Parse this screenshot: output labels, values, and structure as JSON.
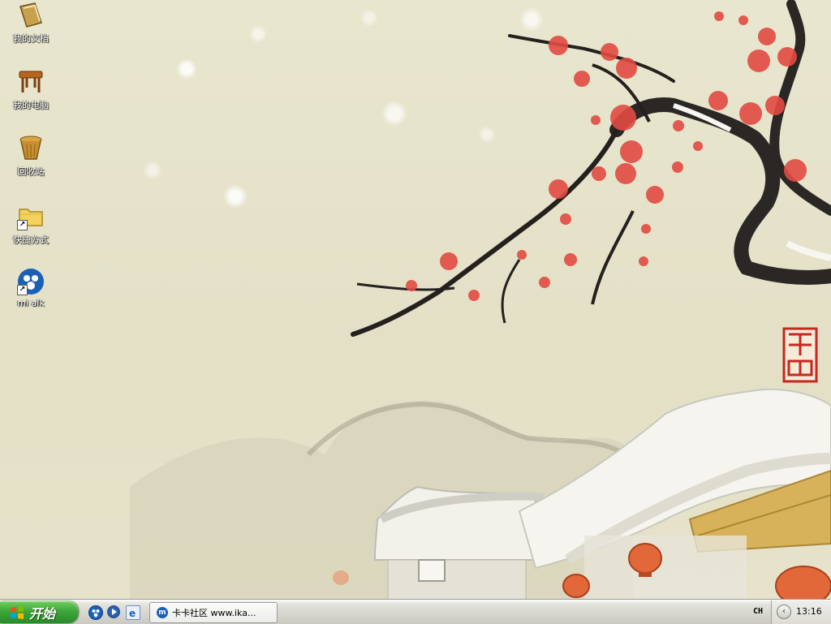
{
  "desktop": {
    "icons": [
      {
        "label": "我的文档",
        "icon": "my-documents-icon"
      },
      {
        "label": "我的电脑",
        "icon": "my-computer-icon"
      },
      {
        "label": "回收站",
        "icon": "recycle-bin-icon"
      },
      {
        "label": "快捷方式",
        "icon": "folder-shortcut-icon"
      },
      {
        "label": "mi alk",
        "icon": "mitalk-icon"
      }
    ]
  },
  "taskbar": {
    "start_label": "开始",
    "quick_launch": [
      "mitalk-quick-icon",
      "media-player-icon",
      "ie-browser-icon"
    ],
    "task_button_label": "卡卡社区 www.ika...",
    "language_indicator": "CH",
    "clock": "13:16"
  },
  "colors": {
    "start_green": "#3ea63a",
    "wallpaper_paper": "#e9e6cf",
    "plum_blossom": "#e0453f",
    "seal_red": "#c8261e"
  }
}
